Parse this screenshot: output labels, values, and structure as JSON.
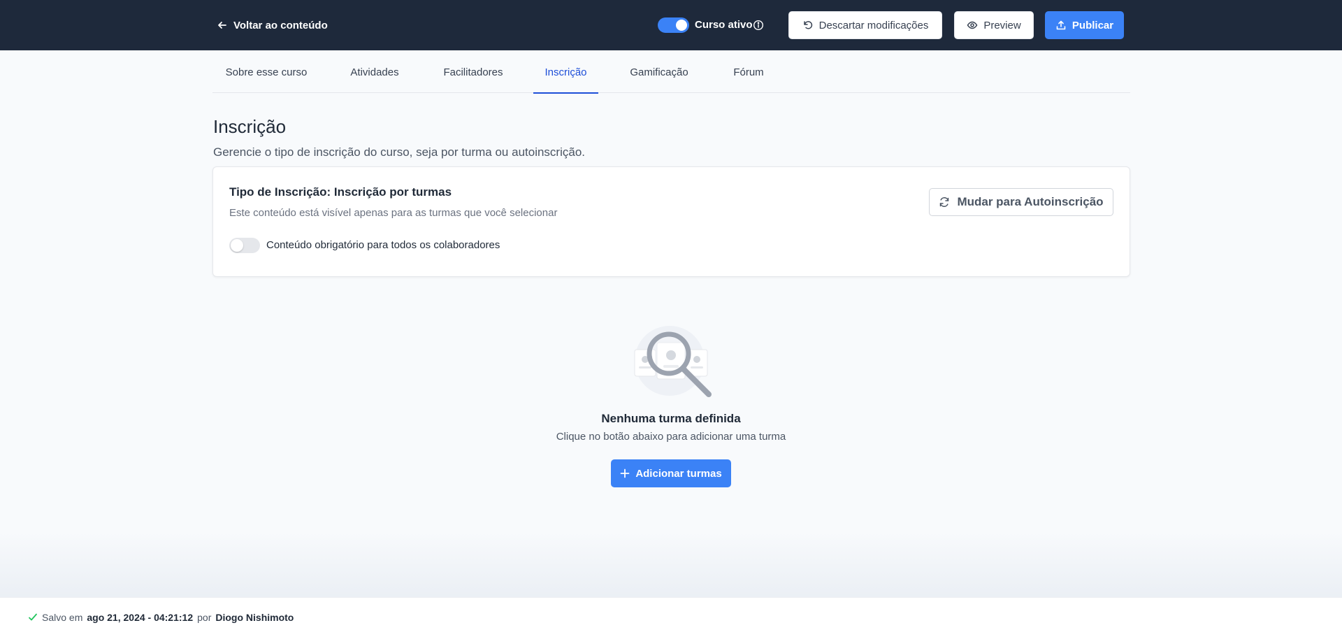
{
  "header": {
    "back_label": "Voltar ao conteúdo",
    "active_toggle_on": true,
    "active_label": "Curso ativo",
    "discard_label": "Descartar modificações",
    "preview_label": "Preview",
    "publish_label": "Publicar"
  },
  "tabs": [
    {
      "label": "Sobre esse curso",
      "active": false
    },
    {
      "label": "Atividades",
      "active": false
    },
    {
      "label": "Facilitadores",
      "active": false
    },
    {
      "label": "Inscrição",
      "active": true
    },
    {
      "label": "Gamificação",
      "active": false
    },
    {
      "label": "Fórum",
      "active": false
    }
  ],
  "page": {
    "title": "Inscrição",
    "subtitle": "Gerencie o tipo de inscrição do curso, seja por turma ou autoinscrição."
  },
  "card": {
    "title": "Tipo de Inscrição: Inscrição por turmas",
    "description": "Este conteúdo está visível apenas para as turmas que você selecionar",
    "mandatory_toggle_on": false,
    "mandatory_label": "Conteúdo obrigatório para todos os colaboradores",
    "switch_button_label": "Mudar para Autoinscrição"
  },
  "empty_state": {
    "title": "Nenhuma turma definida",
    "description": "Clique no botão abaixo para adicionar uma turma",
    "add_button_label": "Adicionar turmas"
  },
  "footer": {
    "saved_prefix": "Salvo em",
    "saved_date": "ago 21, 2024 - 04:21:12",
    "by_label": "por",
    "saved_by": "Diogo Nishimoto"
  },
  "colors": {
    "topbar": "#1e293b",
    "accent": "#3b82f6",
    "tab_active": "#1d4ed8",
    "success": "#22c55e"
  }
}
